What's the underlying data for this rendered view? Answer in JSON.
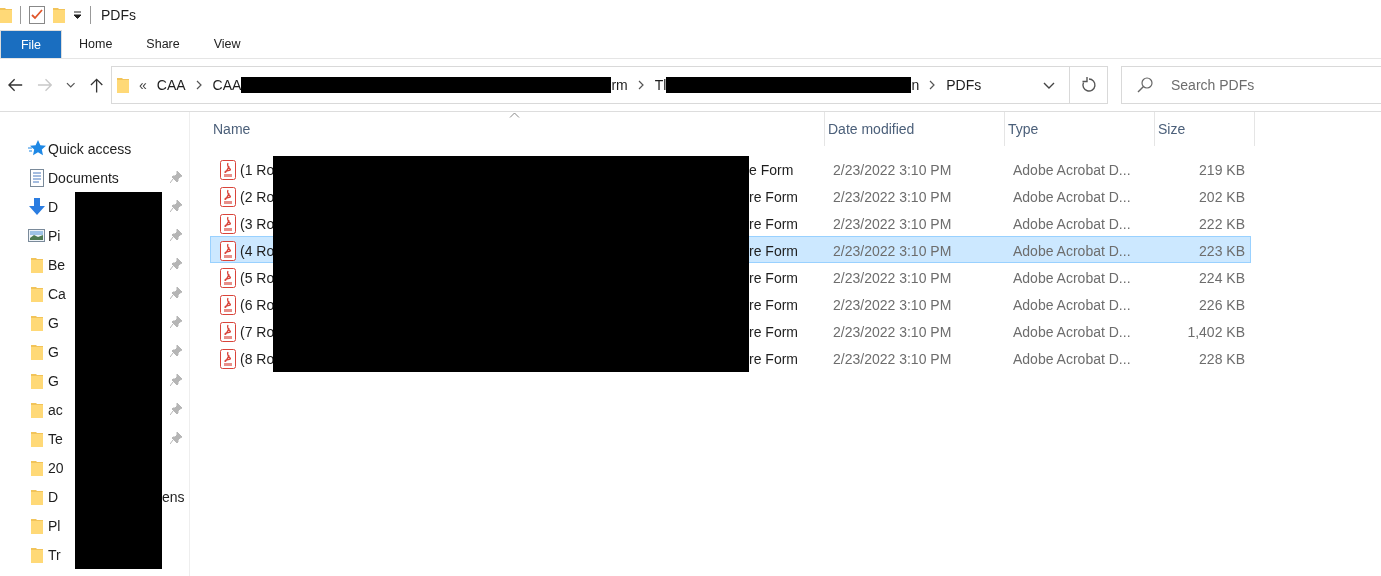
{
  "title_bar": {
    "title": "PDFs"
  },
  "ribbon": {
    "tabs": [
      {
        "label": "File",
        "selected": true,
        "kind": "file"
      },
      {
        "label": "Home",
        "selected": false,
        "kind": "tab"
      },
      {
        "label": "Share",
        "selected": false,
        "kind": "tab"
      },
      {
        "label": "View",
        "selected": false,
        "kind": "tab"
      }
    ]
  },
  "navigation": {
    "forward_disabled": true
  },
  "address_bar": {
    "overflow_marker": "«",
    "crumbs": [
      {
        "text": "CAA",
        "redacted": false
      },
      {
        "text": "CAA",
        "redacted": true,
        "tail": "rm"
      },
      {
        "text": "Tl",
        "redacted": true,
        "tail": "n"
      },
      {
        "text": "PDFs",
        "redacted": false
      }
    ]
  },
  "search": {
    "placeholder": "Search PDFs"
  },
  "sidebar": {
    "items": [
      {
        "kind": "quick-access",
        "head": "Quick access",
        "redacted": false,
        "pinned": false
      },
      {
        "kind": "documents",
        "head": "Documents",
        "redacted": false,
        "pinned": true
      },
      {
        "kind": "downloads",
        "head": "D",
        "redacted": true,
        "pinned": true
      },
      {
        "kind": "pictures",
        "head": "Pi",
        "redacted": true,
        "pinned": true
      },
      {
        "kind": "folder",
        "head": "Be",
        "redacted": true,
        "pinned": true
      },
      {
        "kind": "folder",
        "head": "Ca",
        "redacted": true,
        "pinned": true
      },
      {
        "kind": "folder",
        "head": "G",
        "redacted": true,
        "pinned": true
      },
      {
        "kind": "folder",
        "head": "G",
        "redacted": true,
        "pinned": true
      },
      {
        "kind": "folder",
        "head": "G",
        "redacted": true,
        "pinned": true
      },
      {
        "kind": "folder",
        "head": "ac",
        "redacted": true,
        "pinned": true
      },
      {
        "kind": "folder",
        "head": "Te",
        "redacted": true,
        "pinned": true
      },
      {
        "kind": "folder",
        "head": "20",
        "redacted": true,
        "pinned": false
      },
      {
        "kind": "folder",
        "head": "D",
        "redacted": true,
        "tail": "ens",
        "pinned": false
      },
      {
        "kind": "folder",
        "head": "Pl",
        "redacted": true,
        "pinned": false
      },
      {
        "kind": "folder",
        "head": "Tr",
        "redacted": true,
        "pinned": false
      }
    ]
  },
  "table": {
    "columns": [
      "Name",
      "Date modified",
      "Type",
      "Size"
    ],
    "rows": [
      {
        "name_head": "(1 Ro",
        "name_tail": "e Form",
        "redacted": true,
        "date": "2/23/2022 3:10 PM",
        "type": "Adobe Acrobat D...",
        "size": "219 KB",
        "selected": false
      },
      {
        "name_head": "(2 Ro",
        "name_tail": "re Form",
        "redacted": true,
        "date": "2/23/2022 3:10 PM",
        "type": "Adobe Acrobat D...",
        "size": "202 KB",
        "selected": false
      },
      {
        "name_head": "(3 Ro",
        "name_tail": "re Form",
        "redacted": true,
        "date": "2/23/2022 3:10 PM",
        "type": "Adobe Acrobat D...",
        "size": "222 KB",
        "selected": false
      },
      {
        "name_head": "(4 Ro",
        "name_tail": "re Form",
        "redacted": true,
        "date": "2/23/2022 3:10 PM",
        "type": "Adobe Acrobat D...",
        "size": "223 KB",
        "selected": true
      },
      {
        "name_head": "(5 Ro",
        "name_tail": "re Form",
        "redacted": true,
        "date": "2/23/2022 3:10 PM",
        "type": "Adobe Acrobat D...",
        "size": "224 KB",
        "selected": false
      },
      {
        "name_head": "(6 Ro",
        "name_tail": "re Form",
        "redacted": true,
        "date": "2/23/2022 3:10 PM",
        "type": "Adobe Acrobat D...",
        "size": "226 KB",
        "selected": false
      },
      {
        "name_head": "(7 Ro",
        "name_tail": "re Form",
        "redacted": true,
        "date": "2/23/2022 3:10 PM",
        "type": "Adobe Acrobat D...",
        "size": "1,402 KB",
        "selected": false
      },
      {
        "name_head": "(8 Ro",
        "name_tail": "re Form",
        "redacted": true,
        "date": "2/23/2022 3:10 PM",
        "type": "Adobe Acrobat D...",
        "size": "228 KB",
        "selected": false
      }
    ]
  }
}
